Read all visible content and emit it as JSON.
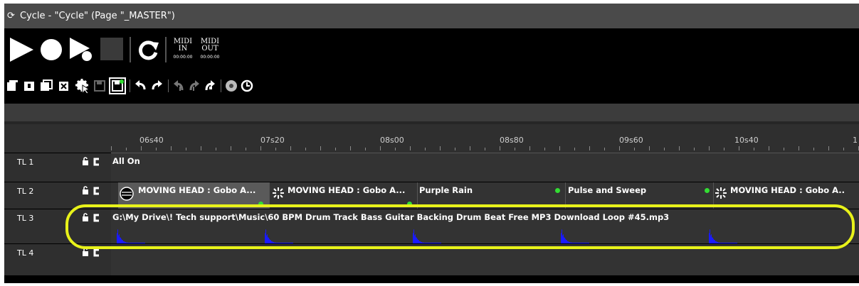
{
  "window": {
    "title": "Cycle - \"Cycle\" (Page \"_MASTER\")"
  },
  "transport": {
    "midi_in": {
      "label_line1": "MIDI",
      "label_line2": "IN",
      "time": "00:00:00"
    },
    "midi_out": {
      "label_line1": "MIDI",
      "label_line2": "OUT",
      "time": "00:00:00"
    }
  },
  "ruler": {
    "labels": [
      "06s40",
      "07s20",
      "08s00",
      "08s80",
      "09s60",
      "10s40",
      "1"
    ]
  },
  "tracks": [
    {
      "label": "TL 1",
      "clips": [
        {
          "name": "All On"
        }
      ]
    },
    {
      "label": "TL 2",
      "clips": [
        {
          "name": "MOVING HEAD : Gobo A..."
        },
        {
          "name": "MOVING HEAD : Gobo A..."
        },
        {
          "name": "Purple Rain"
        },
        {
          "name": "Pulse and Sweep"
        },
        {
          "name": "MOVING HEAD : Gobo A.."
        }
      ]
    },
    {
      "label": "TL 3",
      "clips": [
        {
          "name": "G:\\My Drive\\! Tech support\\Music\\60 BPM Drum Track Bass Guitar Backing Drum Beat Free MP3 Download Loop #45.mp3"
        }
      ]
    },
    {
      "label": "TL 4",
      "clips": []
    }
  ],
  "colors": {
    "accent_highlight": "#e8f21a",
    "cue_dot": "#33dd33",
    "waveform": "#1a1aff"
  },
  "icons": [
    "play-icon",
    "record-icon",
    "play-from-icon",
    "stop-icon",
    "loop-icon",
    "new-icon",
    "import-icon",
    "duplicate-icon",
    "delete-icon",
    "settings-icon",
    "save-icon",
    "save-as-icon",
    "undo-icon",
    "redo-icon",
    "go-start-icon",
    "go-prev-icon",
    "go-next-icon",
    "disk-icon",
    "clock-icon"
  ]
}
